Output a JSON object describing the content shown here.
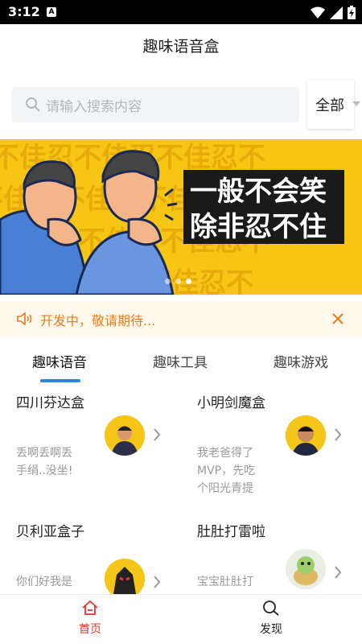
{
  "status_bar": {
    "time": "3:12",
    "notification_letter": "A"
  },
  "header": {
    "title": "趣味语音盒"
  },
  "search": {
    "placeholder": "请输入搜索内容",
    "filter_label": "全部"
  },
  "banner": {
    "line1": "一般不会笑",
    "line2": "除非忍不住",
    "background_text": "不佳忍不佳忍不佳忍不",
    "dots": 3,
    "active_dot": 2
  },
  "notice": {
    "text": "开发中，敬请期待..."
  },
  "tabs": [
    {
      "label": "趣味语音"
    },
    {
      "label": "趣味工具"
    },
    {
      "label": "趣味游戏"
    }
  ],
  "cards": [
    {
      "title": "四川芬达盒",
      "desc": "丢啊丢啊丢手绢..没坐!",
      "avatar": "person-avatar"
    },
    {
      "title": "小明剑魔盒",
      "desc": "我老爸得了MVP，先吃个阳光青提",
      "avatar": "person-avatar"
    },
    {
      "title": "贝利亚盒子",
      "desc": "你们好我是",
      "avatar": "hero-avatar"
    },
    {
      "title": "肚肚打雷啦",
      "desc": "宝宝肚肚打",
      "avatar": "turtle-avatar"
    }
  ],
  "bottom_nav": [
    {
      "label": "首页",
      "active": true
    },
    {
      "label": "发现",
      "active": false
    }
  ],
  "colors": {
    "accent_orange": "#f07b1a",
    "tab_indicator": "#2b83e8",
    "nav_active": "#e8342a",
    "banner_yellow": "#f7c514"
  }
}
